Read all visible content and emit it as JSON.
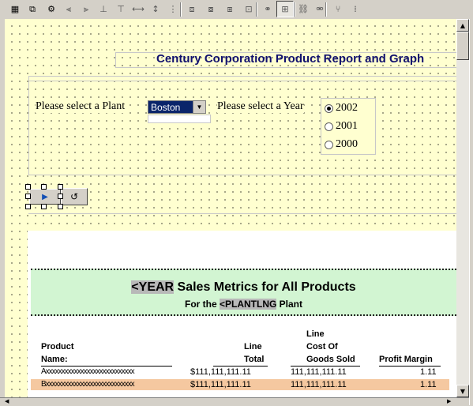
{
  "toolbar": {
    "buttons": [
      {
        "icon": "grid-icon",
        "glyph": "▦"
      },
      {
        "icon": "layout-icon",
        "glyph": "⧉"
      },
      {
        "icon": "properties-icon",
        "glyph": "⚙"
      },
      {
        "icon": "align-left-icon",
        "glyph": "⫷"
      },
      {
        "icon": "align-right-icon",
        "glyph": "⫸"
      },
      {
        "icon": "align-bottom-icon",
        "glyph": "⊥"
      },
      {
        "icon": "align-top-icon",
        "glyph": "⊤"
      },
      {
        "icon": "same-width-icon",
        "glyph": "⟷"
      },
      {
        "icon": "same-height-icon",
        "glyph": "↕"
      },
      {
        "icon": "space-icon",
        "glyph": "⋮"
      },
      {
        "icon": "bring-front-icon",
        "glyph": "⧈"
      },
      {
        "icon": "send-back-icon",
        "glyph": "⧇"
      },
      {
        "icon": "group-icon",
        "glyph": "⧆"
      },
      {
        "icon": "ungroup-icon",
        "glyph": "⊡"
      },
      {
        "icon": "link-icon",
        "glyph": "⚭"
      },
      {
        "icon": "tree-icon",
        "glyph": "⊞"
      },
      {
        "icon": "chain-icon",
        "glyph": "⛓"
      },
      {
        "icon": "unchain-icon",
        "glyph": "⚮"
      },
      {
        "icon": "split-icon",
        "glyph": "⑂"
      },
      {
        "icon": "tab-order-icon",
        "glyph": "⁞"
      }
    ]
  },
  "page": {
    "title": "Century Corporation Product Report and Graph"
  },
  "form": {
    "plant_label": "Please select a Plant",
    "plant_value": "Boston",
    "year_label": "Please select a Year",
    "years": [
      "2002",
      "2001",
      "2000"
    ],
    "selected_year": "2002"
  },
  "report": {
    "heading_token": "<YEAR",
    "heading_rest": " Sales Metrics for All Products",
    "sub_prefix": "For the ",
    "sub_token": "<PLANTLNG",
    "sub_suffix": " Plant",
    "columns": {
      "product_1": "Product",
      "product_2": "Name:",
      "total_1": "Line",
      "total_2": "Total",
      "cogs_1": "Line",
      "cogs_2": "Cost Of",
      "cogs_3": "Goods Sold",
      "margin": "Profit Margin"
    },
    "rows": [
      {
        "name": "Axxxxxxxxxxxxxxxxxxxxxxxxxxxx",
        "total": "$111,111,111.11",
        "cogs": "111,111,111.11",
        "margin": "1.11"
      },
      {
        "name": "Bxxxxxxxxxxxxxxxxxxxxxxxxxxxx",
        "total": "$111,111,111.11",
        "cogs": "111,111,111.11",
        "margin": "1.11"
      }
    ],
    "highlight_color": "#f5c8a0",
    "banner_color": "#d2f5d2"
  },
  "colors": {
    "canvas": "#ffffd0",
    "title": "#10106e",
    "select_bg": "#0a246a"
  }
}
